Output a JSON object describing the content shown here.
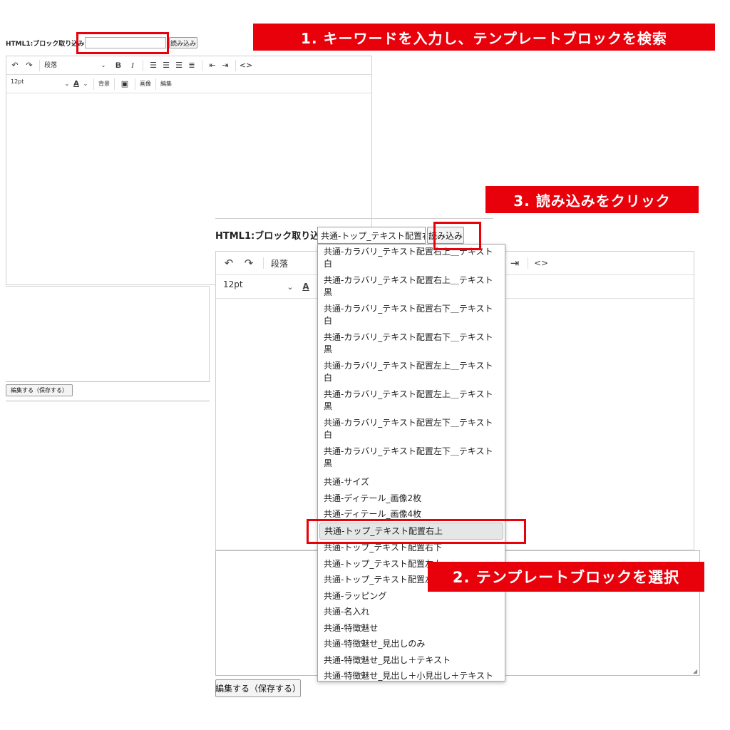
{
  "colors": {
    "callout_red": "#e8000b"
  },
  "small_editor": {
    "label": "HTML1:ブロック取り込み",
    "input_value": "",
    "load_button": "読み込み",
    "toolbar1": {
      "undo_icon": "undo-icon",
      "redo_icon": "redo-icon",
      "block_format": "段落",
      "bold": "B",
      "italic": "I",
      "align_icons": [
        "align-left-icon",
        "align-center-icon",
        "align-right-icon",
        "align-justify-icon"
      ],
      "indent_icons": [
        "outdent-icon",
        "indent-icon"
      ],
      "code": "<>"
    },
    "toolbar2": {
      "font_size": "12pt",
      "text_color": "A",
      "background": "背景",
      "image_icon": "image-icon",
      "image": "画像",
      "edit": "編集"
    },
    "edit_save_button": "編集する（保存する）"
  },
  "large_editor": {
    "label": "HTML1:ブロック取り込み",
    "select_value": "共通-トップ_テキスト配置右上",
    "load_button": "読み込み",
    "block_format": "段落",
    "font_size": "12pt",
    "text_color": "A",
    "code": "<>",
    "edit_save_button": "編集する（保存する）"
  },
  "dropdown": {
    "options": [
      "共通-カラバリ_テキスト配置右上＿テキスト白",
      "共通-カラバリ_テキスト配置右上＿テキスト黒",
      "共通-カラバリ_テキスト配置右下＿テキスト白",
      "共通-カラバリ_テキスト配置右下＿テキスト黒",
      "共通-カラバリ_テキスト配置左上＿テキスト白",
      "共通-カラバリ_テキスト配置左上＿テキスト黒",
      "共通-カラバリ_テキスト配置左下＿テキスト白",
      "共通-カラバリ_テキスト配置左下＿テキスト黒",
      "共通-サイズ",
      "共通-ディテール_画像2枚",
      "共通-ディテール_画像4枚",
      "共通-トップ_テキスト配置右上",
      "共通-トップ_テキスト配置右下",
      "共通-トップ_テキスト配置左上",
      "共通-トップ_テキスト配置左下",
      "共通-ラッピング",
      "共通-名入れ",
      "共通-特徴魅せ",
      "共通-特徴魅せ_見出しのみ",
      "共通-特徴魅せ_見出し＋テキスト",
      "共通-特徴魅せ_見出し＋小見出し＋テキスト"
    ],
    "selected_index": 11
  },
  "callouts": {
    "step1": "1. キーワードを入力し、テンプレートブロックを検索",
    "step2": "2. テンプレートブロックを選択",
    "step3": "3. 読み込みをクリック"
  }
}
